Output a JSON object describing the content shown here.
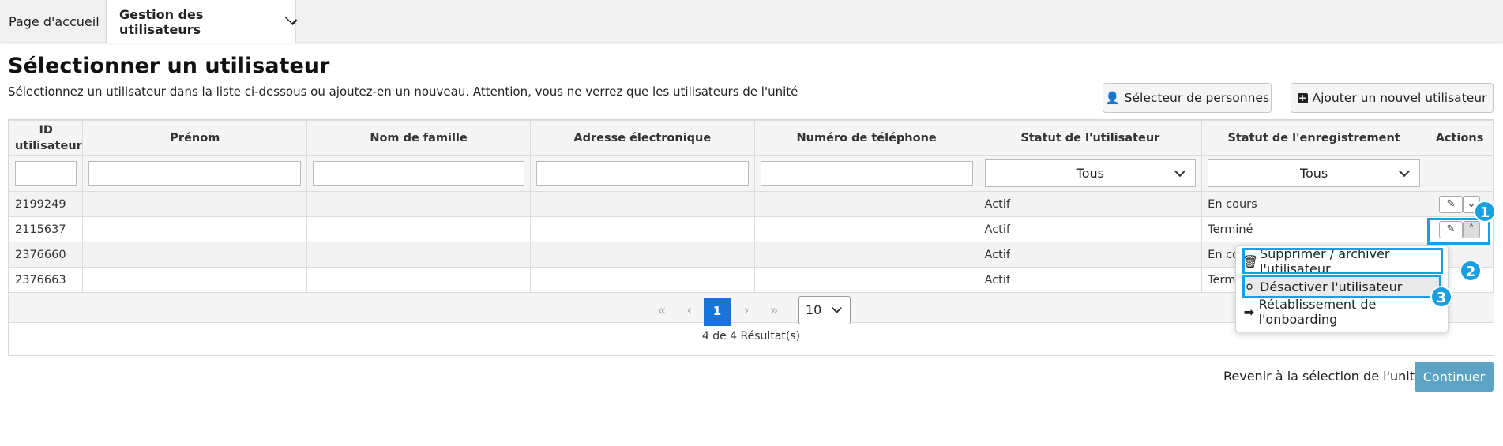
{
  "nav": {
    "home": "Page d'accueil",
    "users": "Gestion des utilisateurs"
  },
  "page": {
    "title": "Sélectionner un utilisateur",
    "subtitle": "Sélectionnez un utilisateur dans la liste ci-dessous ou ajoutez-en un nouveau. Attention, vous ne verrez que les utilisateurs de l'unité"
  },
  "buttons": {
    "persons": "Sélecteur de personnes",
    "add": "Ajouter un nouvel utilisateur"
  },
  "table": {
    "columns": [
      "ID utilisateur",
      "Prénom",
      "Nom de famille",
      "Adresse électronique",
      "Numéro de téléphone",
      "Statut de l'utilisateur",
      "Statut de l'enregistrement",
      "Actions"
    ],
    "filters": {
      "user_status": "Tous",
      "reg_status": "Tous"
    },
    "rows": [
      {
        "id": "2199249",
        "status": "Actif",
        "reg": "En cours"
      },
      {
        "id": "2115637",
        "status": "Actif",
        "reg": "Terminé"
      },
      {
        "id": "2376660",
        "status": "Actif",
        "reg": "En cours"
      },
      {
        "id": "2376663",
        "status": "Actif",
        "reg": "Terminé"
      }
    ]
  },
  "pager": {
    "current": "1",
    "size": "10",
    "results": "4 de 4 Résultat(s)"
  },
  "menu": {
    "delete": "Supprimer / archiver l'utilisateur",
    "deactivate": "Désactiver l'utilisateur",
    "reset": "Rétablissement de l'onboarding"
  },
  "badges": [
    "1",
    "2",
    "3"
  ],
  "footer": {
    "back": "Revenir à la sélection de l'unité",
    "continue": "Continuer"
  },
  "colors": {
    "accent": "#1aa0e0",
    "primary": "#1a73d9",
    "continue": "#5ca3c5"
  }
}
